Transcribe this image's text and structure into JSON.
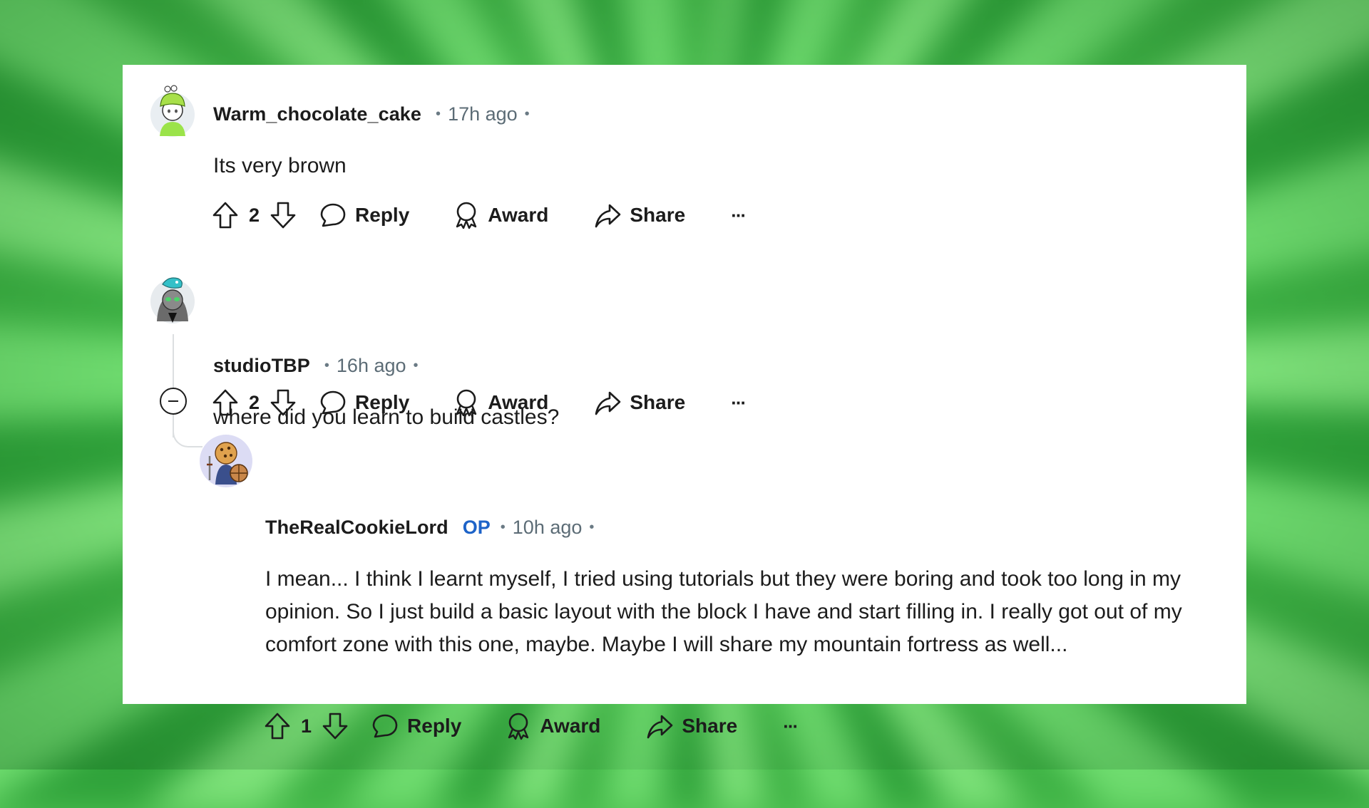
{
  "comments": [
    {
      "username": "Warm_chocolate_cake",
      "time": "17h ago",
      "op_badge": "",
      "body": "Its very brown",
      "score": "2",
      "actions": {
        "reply": "Reply",
        "award": "Award",
        "share": "Share",
        "more": "···"
      }
    },
    {
      "username": "studioTBP",
      "time": "16h ago",
      "op_badge": "",
      "body": "where did you learn to build castles?",
      "score": "2",
      "actions": {
        "reply": "Reply",
        "award": "Award",
        "share": "Share",
        "more": "···"
      }
    },
    {
      "username": "TheRealCookieLord",
      "time": "10h ago",
      "op_badge": "OP",
      "body": "I mean... I think I learnt myself, I tried using tutorials but they were boring and took too long in my opinion. So I just build a basic layout with the block I have and start filling in. I really got out of my comfort zone with this one, maybe. Maybe I will share my mountain fortress as well...",
      "score": "1",
      "actions": {
        "reply": "Reply",
        "award": "Award",
        "share": "Share",
        "more": "···"
      }
    }
  ],
  "separator": "•",
  "icons": {
    "upvote": "arrow-up-outline",
    "downvote": "arrow-down-outline",
    "reply": "speech-bubble",
    "award": "award-ribbon",
    "share": "share-arrow",
    "more": "ellipsis",
    "collapse": "minus-circle"
  },
  "colors": {
    "background_green": "#4fc052",
    "card": "#ffffff",
    "text": "#1c1c1c",
    "meta": "#5c6c76",
    "op_badge": "#1d63c8",
    "thread_line": "#dcdfe1"
  }
}
